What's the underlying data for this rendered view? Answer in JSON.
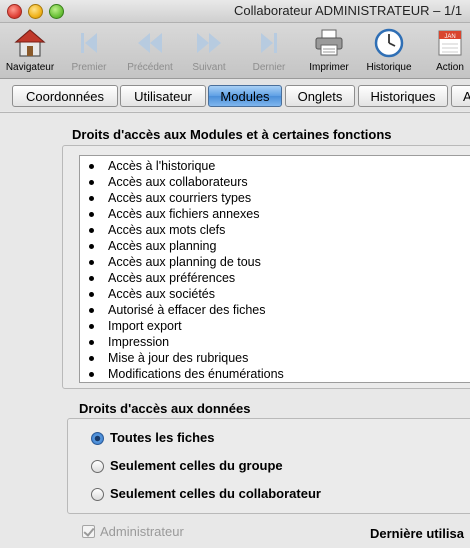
{
  "window": {
    "title": "Collaborateur ADMINISTRATEUR – 1/1"
  },
  "toolbar": {
    "navigateur": "Navigateur",
    "premier": "Premier",
    "precedent": "Précédent",
    "suivant": "Suivant",
    "dernier": "Dernier",
    "imprimer": "Imprimer",
    "historique": "Historique",
    "action": "Action",
    "calendar_badge": "JAN"
  },
  "tabs": {
    "coordonnees": "Coordonnées",
    "utilisateur": "Utilisateur",
    "modules": "Modules",
    "onglets": "Onglets",
    "historiques": "Historiques",
    "next": "A"
  },
  "modules_section": {
    "title": "Droits d'accès aux Modules et à certaines fonctions",
    "items": [
      "Accès à l'historique",
      "Accès aux collaborateurs",
      "Accès aux courriers types",
      "Accès aux fichiers annexes",
      "Accès aux mots clefs",
      "Accès aux planning",
      "Accès aux planning de tous",
      "Accès aux préférences",
      "Accès aux sociétés",
      "Autorisé à effacer des fiches",
      "Import export",
      "Impression",
      "Mise à jour des rubriques",
      "Modifications des énumérations"
    ]
  },
  "data_section": {
    "title": "Droits d'accès aux données",
    "option_all": "Toutes les fiches",
    "option_group": "Seulement celles du groupe",
    "option_collab": "Seulement celles du collaborateur",
    "selected": "Toutes les fiches"
  },
  "footer": {
    "admin_label": "Administrateur",
    "admin_checked": true,
    "last_use_label": "Dernière utilisa"
  },
  "colors": {
    "active_tab": "#5ea0e5",
    "radio_selected": "#3578c9"
  }
}
